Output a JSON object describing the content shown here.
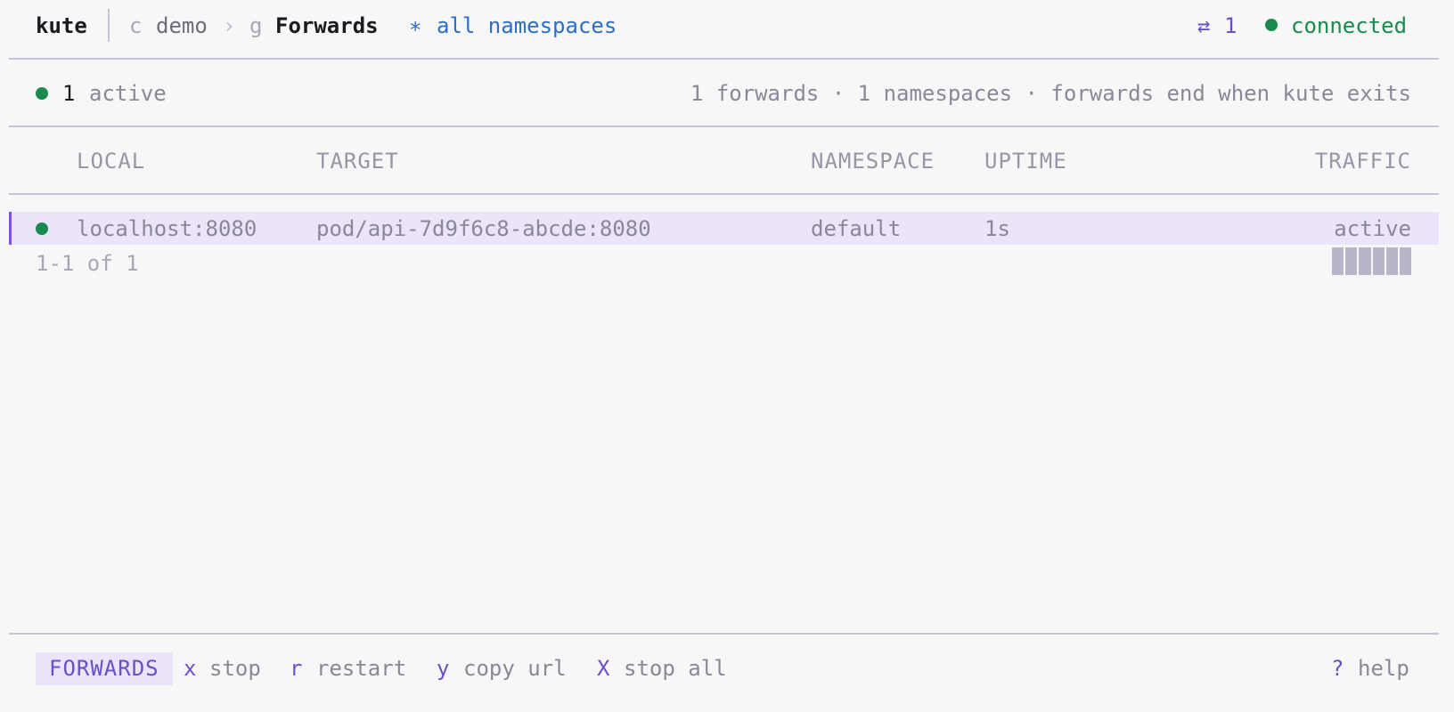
{
  "header": {
    "app": "kute",
    "context_key": "c",
    "context": "demo",
    "chevron": "›",
    "resource_key": "g",
    "resource": "Forwards",
    "ns_glyph": "∗",
    "namespace": "all namespaces",
    "forward_glyph": "⇄",
    "forward_count": "1",
    "status": "connected",
    "status_color": "#1a8a4f"
  },
  "summary": {
    "active_count": "1",
    "active_label": "active",
    "stats": "1 forwards · 1 namespaces · forwards end when kute exits"
  },
  "table": {
    "columns": {
      "local": "LOCAL",
      "target": "TARGET",
      "namespace": "NAMESPACE",
      "uptime": "UPTIME",
      "traffic": "TRAFFIC"
    },
    "rows": [
      {
        "local": "localhost:8080",
        "target": "pod/api-7d9f6c8-abcde:8080",
        "namespace": "default",
        "uptime": "1s",
        "traffic": "active",
        "status": "running"
      }
    ],
    "pagination": "1-1 of 1"
  },
  "footer": {
    "mode": "FORWARDS",
    "keys": [
      {
        "key": "x",
        "label": "stop"
      },
      {
        "key": "r",
        "label": "restart"
      },
      {
        "key": "y",
        "label": "copy url"
      },
      {
        "key": "X",
        "label": "stop all"
      }
    ],
    "help_key": "?",
    "help_label": "help"
  },
  "colors": {
    "accent": "#6a4fc9",
    "selection": "#ebe4fb",
    "ok": "#1a8a4f",
    "link": "#2e6fc4"
  }
}
